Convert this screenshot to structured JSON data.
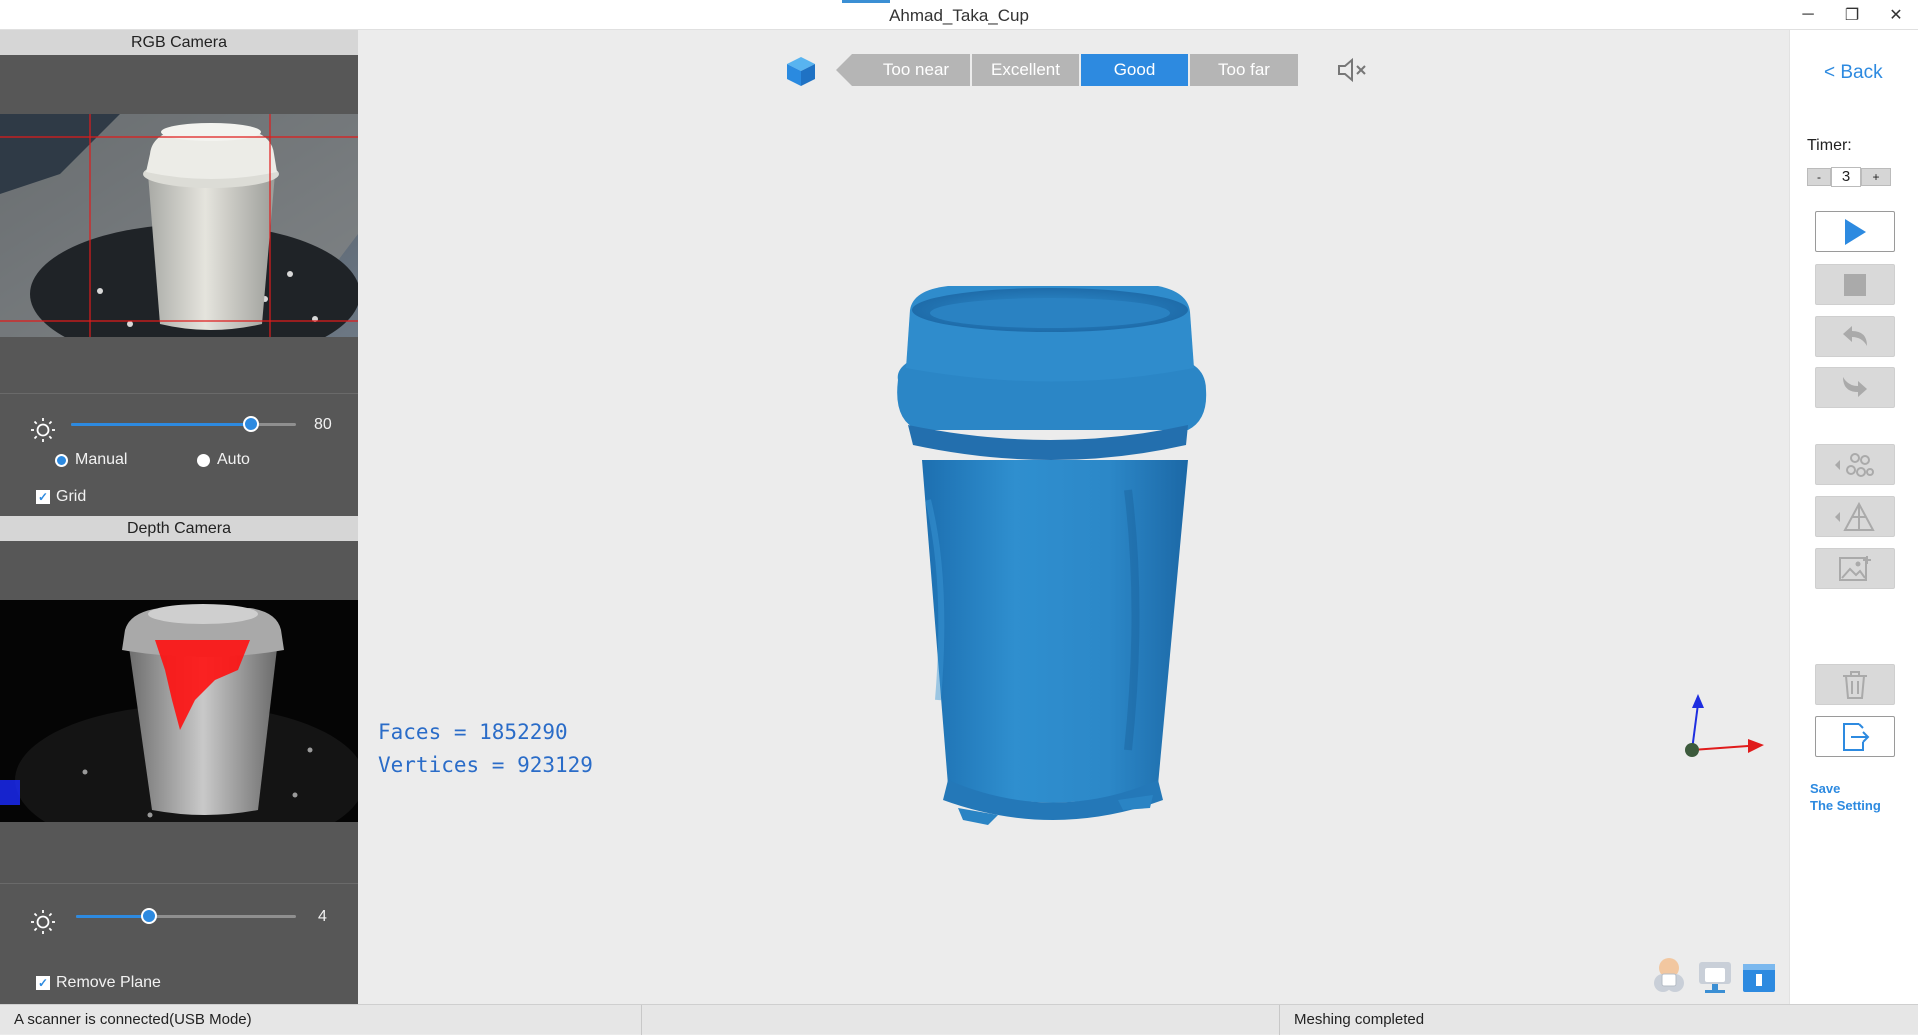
{
  "window": {
    "title": "Ahmad_Taka_Cup",
    "minimize": "─",
    "maximize": "❐",
    "close": "✕"
  },
  "rgb_camera": {
    "header": "RGB Camera",
    "brightness_value": "80",
    "brightness_fraction": 0.8,
    "mode_manual": "Manual",
    "mode_auto": "Auto",
    "selected_mode": "Manual",
    "grid_label": "Grid",
    "grid_checked": true
  },
  "depth_camera": {
    "header": "Depth Camera",
    "exposure_value": "4",
    "exposure_fraction": 0.33,
    "remove_plane_label": "Remove Plane",
    "remove_plane_checked": true
  },
  "distance_indicator": {
    "segments": [
      "Too near",
      "Excellent",
      "Good",
      "Too far"
    ],
    "active": "Good"
  },
  "model_stats": {
    "faces": "Faces = 1852290",
    "vertices": "Vertices = 923129"
  },
  "right_panel": {
    "back_label": "< Back",
    "timer_label": "Timer:",
    "timer_value": "3",
    "timer_minus": "-",
    "timer_plus": "+",
    "save_setting_line1": "Save",
    "save_setting_line2": "The Setting"
  },
  "status_bar": {
    "connection": "A scanner is connected(USB Mode)",
    "middle": "",
    "message": "Meshing completed"
  },
  "colors": {
    "accent": "#2d8ae0",
    "model": "#2c88c8",
    "panel_bg": "#575757"
  }
}
